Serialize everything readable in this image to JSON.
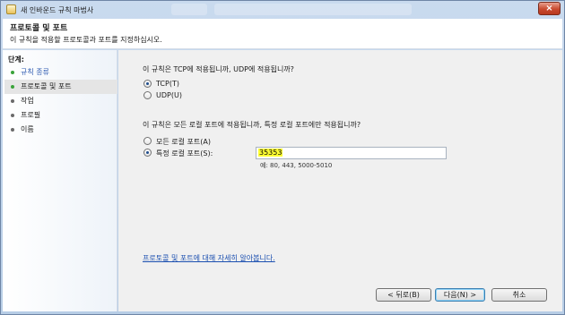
{
  "window": {
    "title": "새 인바운드 규칙 마법사",
    "close_label": "×"
  },
  "header": {
    "title": "프로토콜 및 포트",
    "subtitle": "이 규칙을 적용할 프로토콜과 포트를 지정하십시오."
  },
  "steps": {
    "label": "단계:",
    "items": [
      {
        "label": "규칙 종류",
        "state": "done"
      },
      {
        "label": "프로토콜 및 포트",
        "state": "current"
      },
      {
        "label": "작업",
        "state": "pending"
      },
      {
        "label": "프로필",
        "state": "pending"
      },
      {
        "label": "이름",
        "state": "pending"
      }
    ]
  },
  "protocol": {
    "question": "이 규칙은 TCP에 적용됩니까, UDP에 적용됩니까?",
    "options": [
      {
        "label": "TCP(T)",
        "selected": true
      },
      {
        "label": "UDP(U)",
        "selected": false
      }
    ]
  },
  "ports": {
    "question": "이 규칙은 모든 로컬 포트에 적용됩니까, 특정 로컬 포트에만 적용됩니까?",
    "options": [
      {
        "label": "모든 로컬 포트(A)",
        "selected": false
      },
      {
        "label": "특정 로컬 포트(S):",
        "selected": true
      }
    ],
    "value": "35353",
    "example": "예: 80, 443, 5000-5010"
  },
  "learn_more": "프로토콜 및 포트에 대해 자세히 알아봅니다.",
  "buttons": {
    "back": "< 뒤로(B)",
    "next": "다음(N) >",
    "cancel": "취소"
  }
}
